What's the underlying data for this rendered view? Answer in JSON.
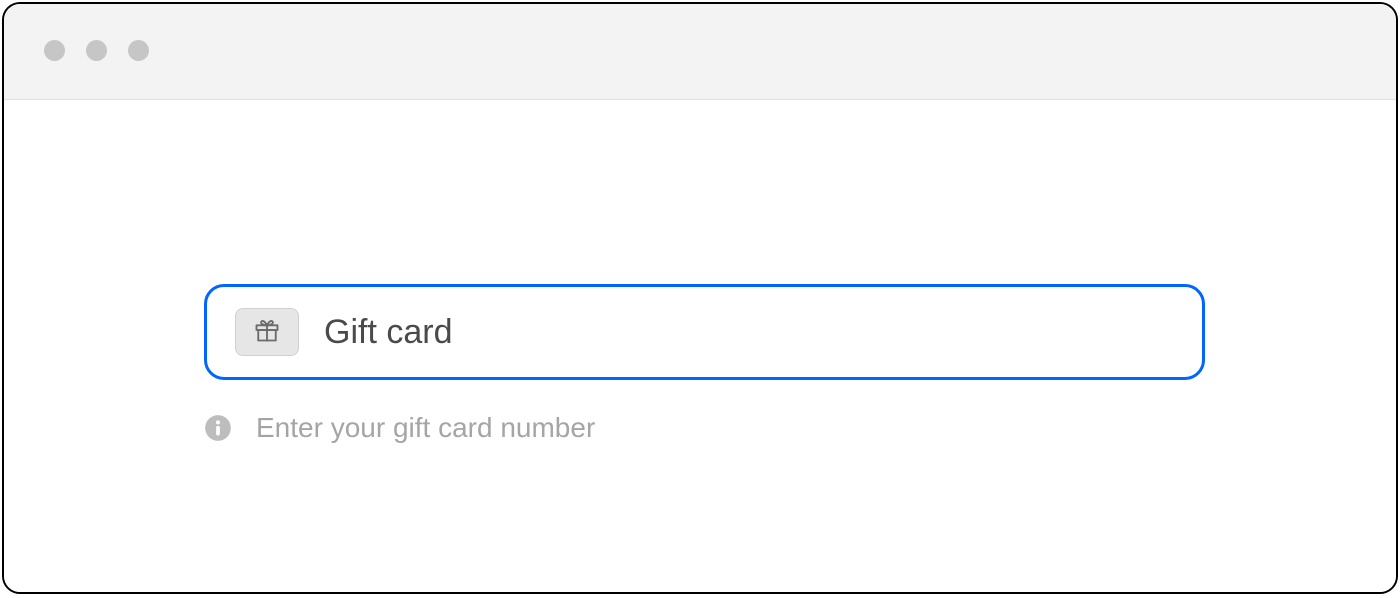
{
  "form": {
    "giftCard": {
      "placeholder": "Gift card",
      "value": "",
      "helper": "Enter your gift card number"
    }
  }
}
